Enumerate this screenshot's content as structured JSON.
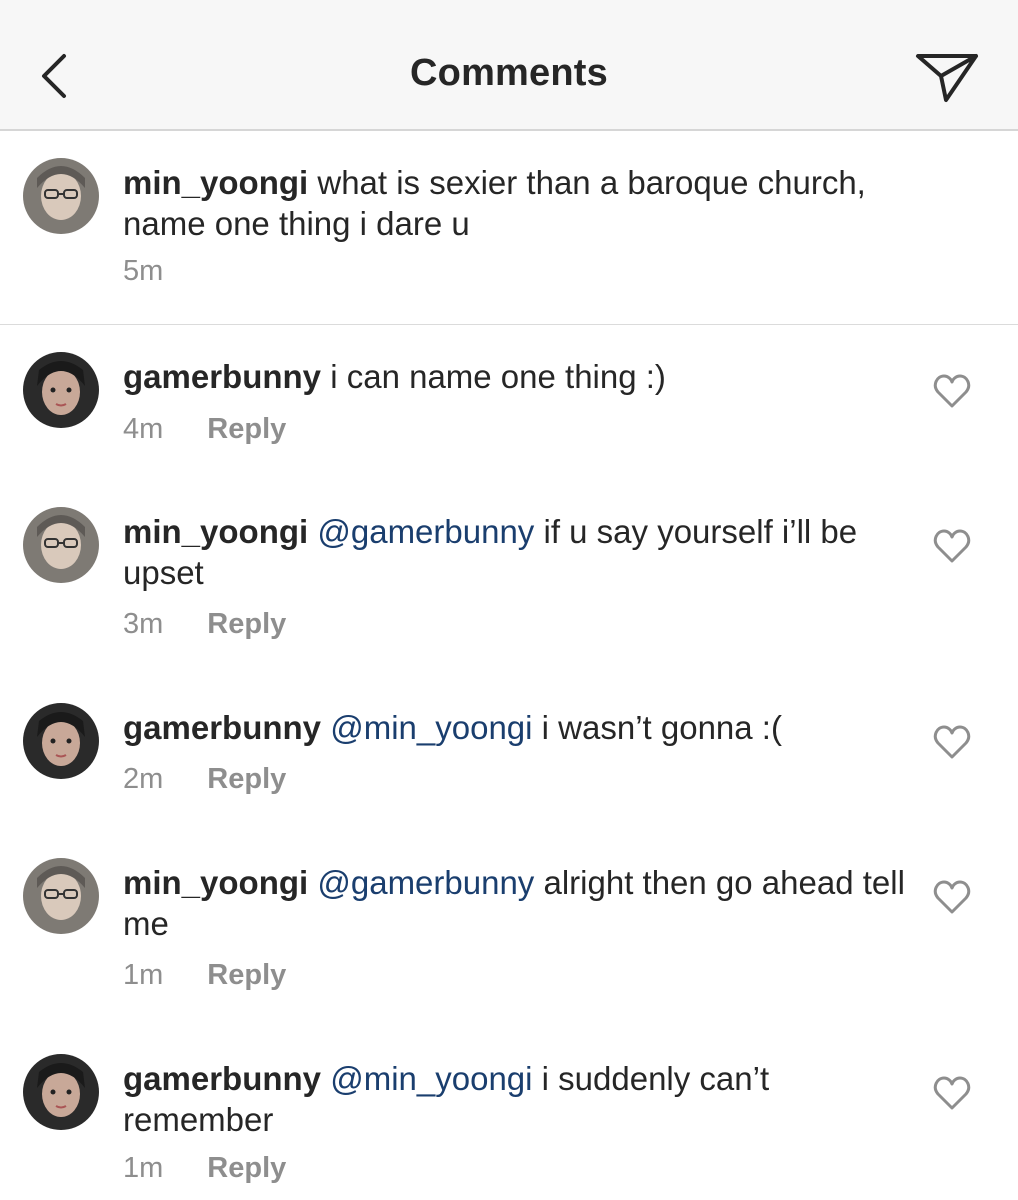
{
  "header": {
    "title": "Comments",
    "back_icon": "chevron-left-icon",
    "share_icon": "paper-plane-icon"
  },
  "caption": {
    "username": "min_yoongi",
    "text": " what is sexier than a baroque church, name one thing i dare u",
    "time": "5m"
  },
  "comments": [
    {
      "username": "gamerbunny",
      "mention": "",
      "text": " i can name one thing :)",
      "time": "4m",
      "reply_label": "Reply"
    },
    {
      "username": "min_yoongi",
      "mention": "@gamerbunny",
      "text": " if u say yourself i’ll be upset",
      "time": "3m",
      "reply_label": "Reply"
    },
    {
      "username": "gamerbunny",
      "mention": "@min_yoongi",
      "text": " i wasn’t gonna :(",
      "time": "2m",
      "reply_label": "Reply"
    },
    {
      "username": "min_yoongi",
      "mention": "@gamerbunny",
      "text": " alright then go ahead tell me",
      "time": "1m",
      "reply_label": "Reply"
    },
    {
      "username": "gamerbunny",
      "mention": "@min_yoongi",
      "text": " i suddenly can’t remember",
      "time": "1m",
      "reply_label": "Reply"
    }
  ],
  "colors": {
    "mention": "#1a3e6e",
    "meta": "#8e8e8e",
    "text": "#262626"
  }
}
